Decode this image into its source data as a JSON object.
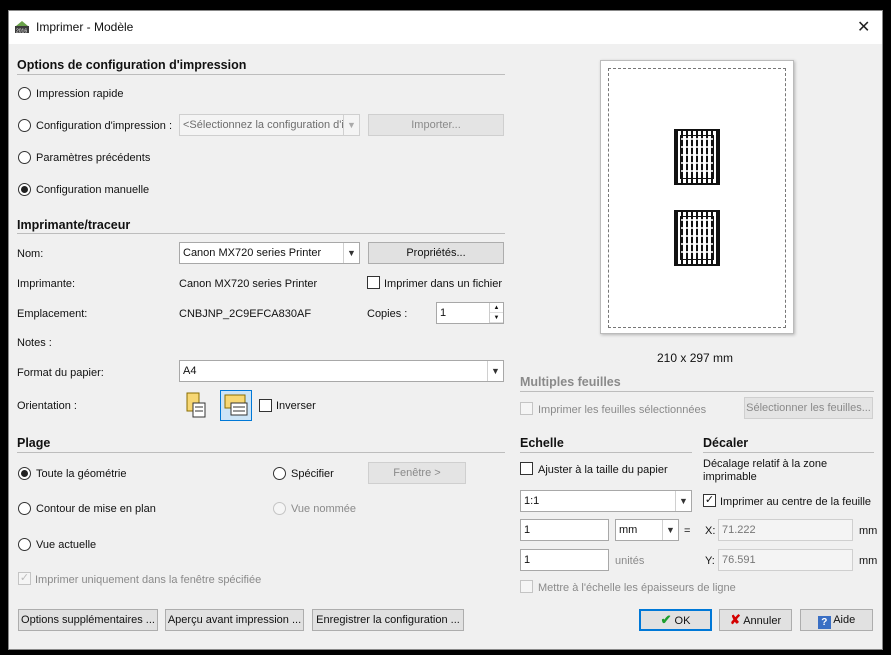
{
  "window": {
    "title": "Imprimer - Modèle",
    "close_glyph": "✕",
    "app_icon": "autocad-2016-icon"
  },
  "options": {
    "heading": "Options de configuration d'impression",
    "rapide": "Impression rapide",
    "config": "Configuration d'impression :",
    "config_placeholder": "<Sélectionnez la configuration d'in",
    "importer": "Importer...",
    "precedents": "Paramètres précédents",
    "manuelle": "Configuration manuelle",
    "selected": "manuelle"
  },
  "printer": {
    "heading": "Imprimante/traceur",
    "nom_label": "Nom:",
    "nom_value": "Canon MX720 series Printer",
    "proprietes": "Propriétés...",
    "imprimante_label": "Imprimante:",
    "imprimante_value": "Canon MX720 series Printer",
    "fichier": "Imprimer dans un fichier",
    "emplacement_label": "Emplacement:",
    "emplacement_value": "CNBJNP_2C9EFCA830AF",
    "copies_label": "Copies :",
    "copies_value": "1",
    "notes_label": "Notes :",
    "format_label": "Format du papier:",
    "format_value": "A4",
    "orientation_label": "Orientation :",
    "inverser": "Inverser"
  },
  "plage": {
    "heading": "Plage",
    "toute": "Toute la géométrie",
    "specifier": "Spécifier",
    "fenetre": "Fenêtre >",
    "contour": "Contour de mise en plan",
    "vue_nommee": "Vue nommée",
    "vue_actuelle": "Vue actuelle",
    "fenetre_only": "Imprimer uniquement dans la fenêtre spécifiée"
  },
  "preview": {
    "size": "210 x 297 mm"
  },
  "multiples": {
    "heading": "Multiples feuilles",
    "imprimer_sel": "Imprimer les feuilles sélectionnées",
    "selectionner": "Sélectionner les feuilles..."
  },
  "echelle": {
    "heading": "Echelle",
    "ajuster": "Ajuster à la taille du papier",
    "ratio": "1:1",
    "v1": "1",
    "unit": "mm",
    "equals": "=",
    "v2": "1",
    "unites": "unités",
    "epaisseurs": "Mettre à l'échelle les épaisseurs de ligne"
  },
  "decaler": {
    "heading": "Décaler",
    "desc": "Décalage relatif à la zone imprimable",
    "centre": "Imprimer au centre de la feuille",
    "x_label": "X:",
    "x_value": "71.222",
    "x_unit": "mm",
    "y_label": "Y:",
    "y_value": "76.591",
    "y_unit": "mm"
  },
  "footer": {
    "options_sup": "Options supplémentaires ...",
    "apercu": "Aperçu avant impression ...",
    "enregistrer": "Enregistrer la configuration ...",
    "ok": "OK",
    "annuler": "Annuler",
    "aide": "Aide"
  },
  "colors": {
    "accent": "#0078d7",
    "ok_check": "#1e9e2e",
    "cancel_x": "#d40000",
    "help": "#3a6fc4"
  }
}
